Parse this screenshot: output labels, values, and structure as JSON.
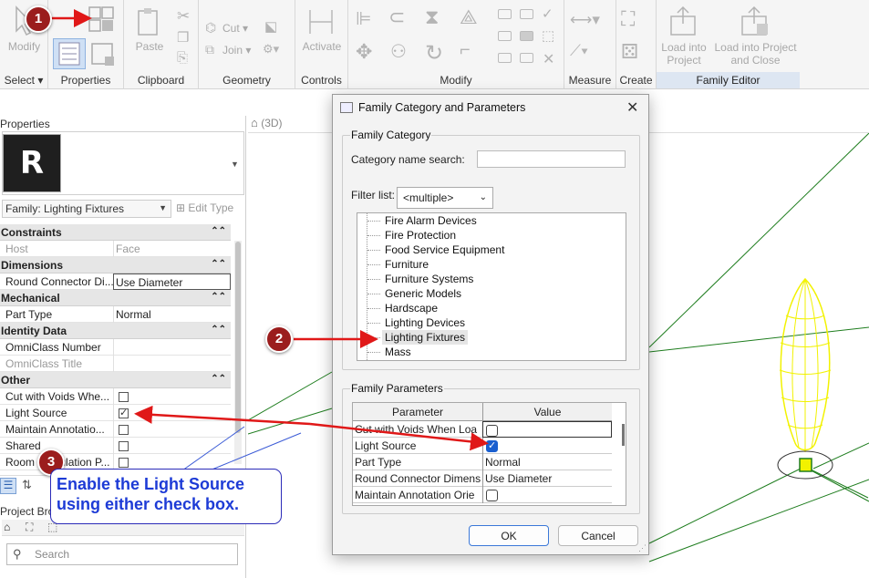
{
  "ribbon": {
    "groups": {
      "select": "Select",
      "properties": "Properties",
      "clipboard": "Clipboard",
      "geometry": "Geometry",
      "controls": "Controls",
      "modify": "Modify",
      "measure": "Measure",
      "create": "Create",
      "family_editor": "Family Editor"
    },
    "buttons": {
      "modify": "Modify",
      "paste": "Paste",
      "cut": "Cut",
      "join": "Join",
      "activate": "Activate",
      "load_into_project": "Load into Project",
      "load_into_project_close": "Load into Project and Close"
    }
  },
  "properties_panel": {
    "title": "Properties",
    "type_tile_letter": "R",
    "family_selector": "Family: Lighting Fixtures",
    "edit_type": "Edit Type",
    "rows": [
      {
        "kind": "category",
        "label": "Constraints",
        "chevron": "⌃⌃"
      },
      {
        "kind": "row",
        "label": "Host",
        "value": "Face",
        "dim": true
      },
      {
        "kind": "category",
        "label": "Dimensions",
        "chevron": "⌃⌃"
      },
      {
        "kind": "row",
        "label": "Round Connector Di...",
        "value": "Use Diameter",
        "boxed": true
      },
      {
        "kind": "category",
        "label": "Mechanical",
        "chevron": "⌃⌃"
      },
      {
        "kind": "row",
        "label": "Part Type",
        "value": "Normal"
      },
      {
        "kind": "category",
        "label": "Identity Data",
        "chevron": "⌃⌃"
      },
      {
        "kind": "row",
        "label": "OmniClass Number",
        "value": ""
      },
      {
        "kind": "row",
        "label": "OmniClass Title",
        "value": "",
        "dim": true
      },
      {
        "kind": "category",
        "label": "Other",
        "chevron": "⌃⌃"
      },
      {
        "kind": "check",
        "label": "Cut with Voids Whe...",
        "checked": false
      },
      {
        "kind": "check",
        "label": "Light Source",
        "checked": true
      },
      {
        "kind": "check",
        "label": "Maintain Annotatio...",
        "checked": false
      },
      {
        "kind": "check",
        "label": "Shared",
        "checked": false
      },
      {
        "kind": "check",
        "label": "Room Calculation P...",
        "checked": false
      }
    ],
    "project_browser": "Project Bro",
    "search_placeholder": "Search"
  },
  "view": {
    "tab_label": "(3D)"
  },
  "dialog": {
    "title": "Family Category and Parameters",
    "category_section": "Family Category",
    "category_search_label": "Category name search:",
    "category_search_value": "",
    "filter_label": "Filter list:",
    "filter_value": "<multiple>",
    "categories": [
      "Fire Alarm Devices",
      "Fire Protection",
      "Food Service Equipment",
      "Furniture",
      "Furniture Systems",
      "Generic Models",
      "Hardscape",
      "Lighting Devices",
      "Lighting Fixtures",
      "Mass"
    ],
    "selected_category": "Lighting Fixtures",
    "params_section": "Family Parameters",
    "param_headers": {
      "parameter": "Parameter",
      "value": "Value"
    },
    "params": [
      {
        "name": "Cut with Voids When Loa",
        "type": "check",
        "checked": false
      },
      {
        "name": "Light Source",
        "type": "check",
        "checked": true
      },
      {
        "name": "Part Type",
        "type": "text",
        "value": "Normal"
      },
      {
        "name": "Round Connector Dimens",
        "type": "text",
        "value": "Use Diameter"
      },
      {
        "name": "Maintain Annotation Orie",
        "type": "check",
        "checked": false
      }
    ],
    "ok": "OK",
    "cancel": "Cancel"
  },
  "callouts": {
    "badge1": "1",
    "badge2": "2",
    "badge3": "3",
    "note": "Enable the Light Source using either check box."
  },
  "colors": {
    "callout_red": "#9b1d1d",
    "arrow_red": "#e01818",
    "callout_text": "#1d3bd6",
    "light_fixture": "#f2f200",
    "grid_green": "#1e7d1e",
    "checkbox_blue": "#1a5fcf"
  }
}
